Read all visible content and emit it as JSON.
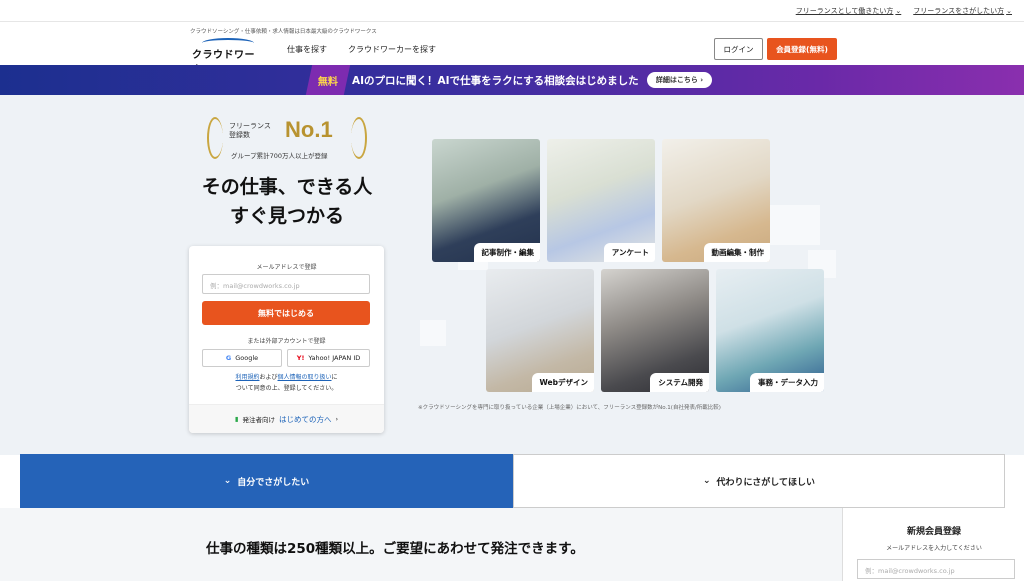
{
  "top_links": [
    "フリーランスとして働きたい方",
    "フリーランスをさがしたい方"
  ],
  "header": {
    "tagline": "クラウドソーシング・仕事依頼・求人情報は日本最大級のクラウドワークス",
    "logo_text": "クラウドワークス",
    "nav": [
      "仕事を探す",
      "クラウドワーカーを探す"
    ],
    "login": "ログイン",
    "signup": "会員登録(無料)"
  },
  "banner": {
    "badge": "無料",
    "text": "AIのプロに聞く！AIで仕事をラクにする相談会はじめました",
    "detail": "詳細はこちら"
  },
  "hero": {
    "no1_small_1": "フリーランス",
    "no1_small_2": "登録数",
    "no1_big": "No.1",
    "no1_sub": "グループ累計700万人以上が登録",
    "headline_1": "その仕事、できる人",
    "headline_2": "すぐ見つかる",
    "note": "※クラウドソーシングを専門に取り扱っている企業（上場企業）において、フリーランス登録数がNo.1(自社発表/所載比較)"
  },
  "signup_card": {
    "email_label": "メールアドレスで登録",
    "email_placeholder": "例：mail@crowdworks.co.jp",
    "start_button": "無料ではじめる",
    "external_label": "または外部アカウントで登録",
    "google": "Google",
    "yahoo": "Yahoo! JAPAN ID",
    "terms_link": "利用規約",
    "terms_and": "および",
    "privacy_link": "個人情報の取り扱い",
    "terms_suffix": "に",
    "terms_line2": "ついて同意の上、登録してください。",
    "footer_prefix": "発注者向け",
    "footer_link": "はじめての方へ"
  },
  "categories": [
    "記事制作・編集",
    "アンケート",
    "動画編集・制作",
    "Webデザイン",
    "システム開発",
    "事務・データ入力"
  ],
  "tabs": {
    "left": "自分でさがしたい",
    "right": "代わりにさがしてほしい"
  },
  "lower": {
    "title": "仕事の種類は250種類以上。ご要望にあわせて発注できます。"
  },
  "sidebox": {
    "title": "新規会員登録",
    "sub": "メールアドレスを入力してください",
    "placeholder": "例：mail@crowdworks.co.jp"
  },
  "colors": {
    "accent": "#e8541e",
    "brand_blue": "#2563b8",
    "gold": "#b89330"
  }
}
